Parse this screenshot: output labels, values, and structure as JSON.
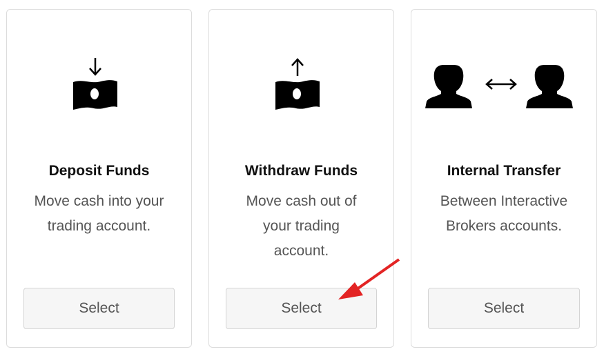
{
  "cards": [
    {
      "icon": "money-deposit-icon",
      "title": "Deposit Funds",
      "desc_lines": [
        "Move cash into your",
        "trading account."
      ],
      "button_label": "Select"
    },
    {
      "icon": "money-withdraw-icon",
      "title": "Withdraw Funds",
      "desc_lines": [
        "Move cash out of",
        "your trading",
        "account."
      ],
      "button_label": "Select"
    },
    {
      "icon": "internal-transfer-icon",
      "title": "Internal Transfer",
      "desc_lines": [
        "Between Interactive",
        "Brokers accounts."
      ],
      "button_label": "Select"
    }
  ],
  "colors": {
    "annotation_arrow": "#e32424",
    "icon": "#000000",
    "border": "#dcdcdc",
    "button_bg": "#f6f6f6"
  }
}
